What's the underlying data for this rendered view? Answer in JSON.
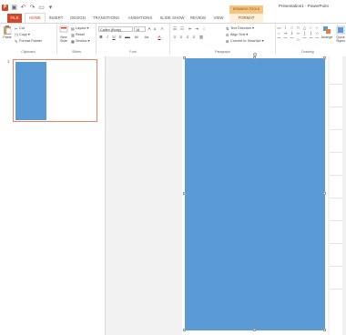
{
  "window": {
    "title": "Presentation1 - PowerPoint",
    "contextual_tab_group": "DRAWING TOOLS"
  },
  "qat": {
    "app_icon": "P",
    "undo_icon": "undo-icon",
    "redo_icon": "redo-icon",
    "start_icon": "present-icon",
    "save_icon": "save-icon"
  },
  "tabs": [
    {
      "label": "FILE"
    },
    {
      "label": "HOME"
    },
    {
      "label": "INSERT"
    },
    {
      "label": "DESIGN"
    },
    {
      "label": "TRANSITIONS"
    },
    {
      "label": "ANIMATIONS"
    },
    {
      "label": "SLIDE SHOW"
    },
    {
      "label": "REVIEW"
    },
    {
      "label": "VIEW"
    },
    {
      "label": "FORMAT"
    }
  ],
  "ribbon": {
    "clipboard": {
      "label": "Clipboard",
      "paste": "Paste",
      "cut": "Cut",
      "copy": "Copy",
      "format_painter": "Format Painter"
    },
    "slides": {
      "label": "Slides",
      "new_slide": "New Slide",
      "layout": "Layout",
      "reset": "Reset",
      "section": "Section"
    },
    "font": {
      "label": "Font",
      "font_name": "Calibri (Body)",
      "font_size": "18",
      "grow": "A",
      "shrink": "A",
      "clear": "A",
      "bold": "B",
      "italic": "I",
      "underline": "U",
      "shadow": "S",
      "strike": "abc",
      "spacing": "AV",
      "case": "Aa",
      "color": "A"
    },
    "paragraph": {
      "label": "Paragraph",
      "text_direction": "Text Direction",
      "align_text": "Align Text",
      "convert_smartart": "Convert to SmartArt"
    },
    "drawing": {
      "label": "Drawing",
      "arrange": "Arrange",
      "quick_styles": "Quick Styles",
      "shape_glyphs": [
        "▭",
        "\\",
        "○",
        "□",
        "△",
        "⌐",
        "⌐",
        "⌐",
        "⇒",
        "⇩",
        "⇦",
        "{",
        "}",
        "☆",
        "⌒",
        "⌒",
        "⌒",
        "☆",
        "⌒",
        "⌒",
        "⌒"
      ]
    }
  },
  "slides_pane": {
    "slide_number": "1"
  },
  "colors": {
    "accent": "#d24726",
    "shape_fill": "#5b9bd5",
    "drawing_tools": "#f4c580"
  }
}
